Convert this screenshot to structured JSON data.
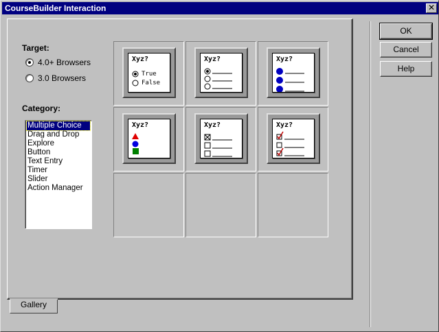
{
  "window": {
    "title": "CourseBuilder Interaction",
    "close_glyph": "✕"
  },
  "buttons": {
    "ok": "OK",
    "cancel": "Cancel",
    "help": "Help"
  },
  "target": {
    "label": "Target:",
    "options": [
      {
        "label": "4.0+ Browsers",
        "selected": true
      },
      {
        "label": "3.0 Browsers",
        "selected": false
      }
    ]
  },
  "category": {
    "label": "Category:",
    "items": [
      "Multiple Choice",
      "Drag and Drop",
      "Explore",
      "Button",
      "Text Entry",
      "Timer",
      "Slider",
      "Action Manager"
    ],
    "selected_index": 0
  },
  "gallery": {
    "tab_label": "Gallery",
    "tiles": [
      {
        "title": "Xyz?",
        "kind": "true-false",
        "icon": "true-false-radio-icon",
        "lines": [
          "True",
          "False"
        ]
      },
      {
        "title": "Xyz?",
        "kind": "multiple-choice-radio",
        "icon": "radio-list-icon"
      },
      {
        "title": "Xyz?",
        "kind": "multiple-choice-image",
        "icon": "image-radio-list-icon"
      },
      {
        "title": "Xyz?",
        "kind": "shapes",
        "icon": "shapes-icon"
      },
      {
        "title": "Xyz?",
        "kind": "checkbox-x",
        "icon": "checkbox-list-icon"
      },
      {
        "title": "Xyz?",
        "kind": "checkbox-check",
        "icon": "checkmark-list-icon"
      }
    ]
  },
  "colors": {
    "titlebar": "#000080",
    "face": "#c0c0c0",
    "selection": "#000080"
  }
}
